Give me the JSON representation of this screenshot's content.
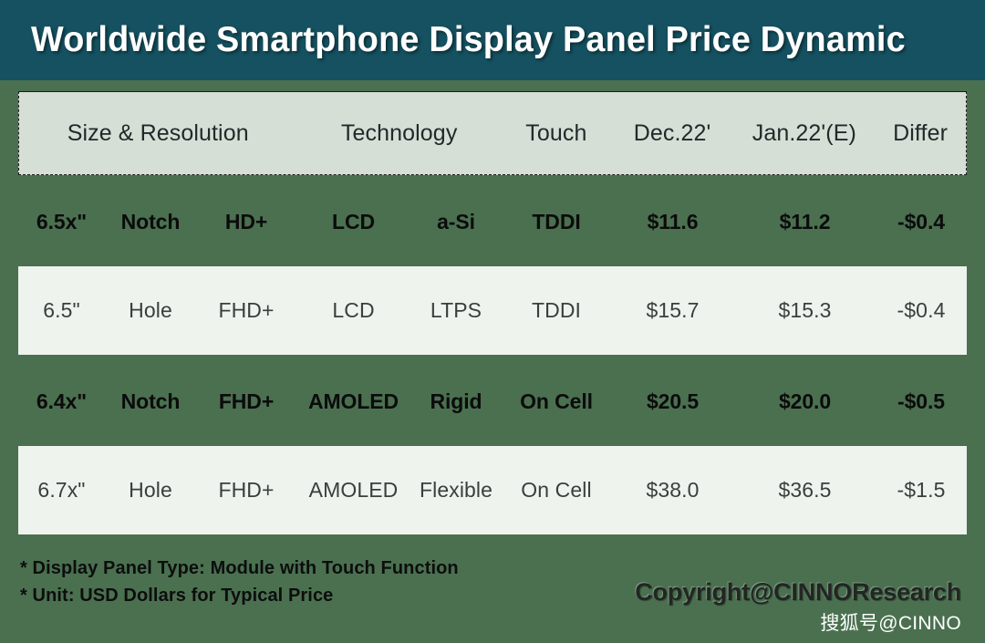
{
  "title": "Worldwide Smartphone Display Panel Price Dynamic",
  "table": {
    "header": {
      "size_resolution": "Size & Resolution",
      "technology": "Technology",
      "touch": "Touch",
      "dec": "Dec.22'",
      "jan": "Jan.22'(E)",
      "differ": "Differ"
    },
    "rows": [
      {
        "size": "6.5x\"",
        "notch": "Notch",
        "resolution": "HD+",
        "technology": "LCD",
        "backplane": "a-Si",
        "touch": "TDDI",
        "dec": "$11.6",
        "jan": "$11.2",
        "differ": "-$0.4",
        "style": "dark"
      },
      {
        "size": "6.5\"",
        "notch": "Hole",
        "resolution": "FHD+",
        "technology": "LCD",
        "backplane": "LTPS",
        "touch": "TDDI",
        "dec": "$15.7",
        "jan": "$15.3",
        "differ": "-$0.4",
        "style": "light"
      },
      {
        "size": "6.4x\"",
        "notch": "Notch",
        "resolution": "FHD+",
        "technology": "AMOLED",
        "backplane": "Rigid",
        "touch": "On Cell",
        "dec": "$20.5",
        "jan": "$20.0",
        "differ": "-$0.5",
        "style": "dark"
      },
      {
        "size": "6.7x\"",
        "notch": "Hole",
        "resolution": "FHD+",
        "technology": "AMOLED",
        "backplane": "Flexible",
        "touch": "On Cell",
        "dec": "$38.0",
        "jan": "$36.5",
        "differ": "-$1.5",
        "style": "light"
      }
    ]
  },
  "notes": {
    "line1": "* Display Panel Type:  Module with Touch Function",
    "line2": "* Unit:  USD Dollars for Typical Price"
  },
  "watermark": {
    "copyright": "Copyright@CINNOResearch",
    "sohu": "搜狐号@CINNO"
  },
  "colors": {
    "title_bar": "#155160",
    "background_green": "#4a7050",
    "header_sage": "#d6dfd6",
    "row_light": "#eef3ee"
  }
}
